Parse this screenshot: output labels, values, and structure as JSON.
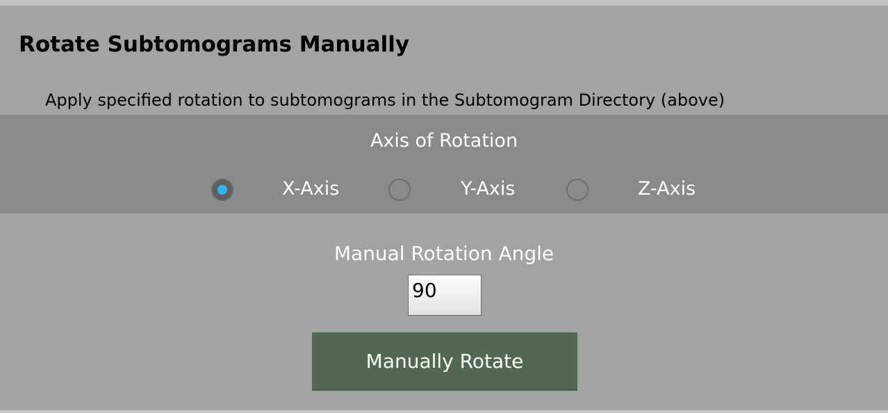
{
  "section": {
    "title": "Rotate Subtomograms Manually",
    "description": "Apply specified rotation to subtomograms in the Subtomogram Directory (above)"
  },
  "axis": {
    "heading": "Axis of Rotation",
    "options": [
      {
        "label": "X-Axis",
        "checked": true
      },
      {
        "label": "Y-Axis",
        "checked": false
      },
      {
        "label": "Z-Axis",
        "checked": false
      }
    ],
    "selected_color": "#2fb5ec"
  },
  "angle": {
    "label": "Manual Rotation Angle",
    "value": "90"
  },
  "button": {
    "label": "Manually Rotate",
    "color": "#536853"
  }
}
